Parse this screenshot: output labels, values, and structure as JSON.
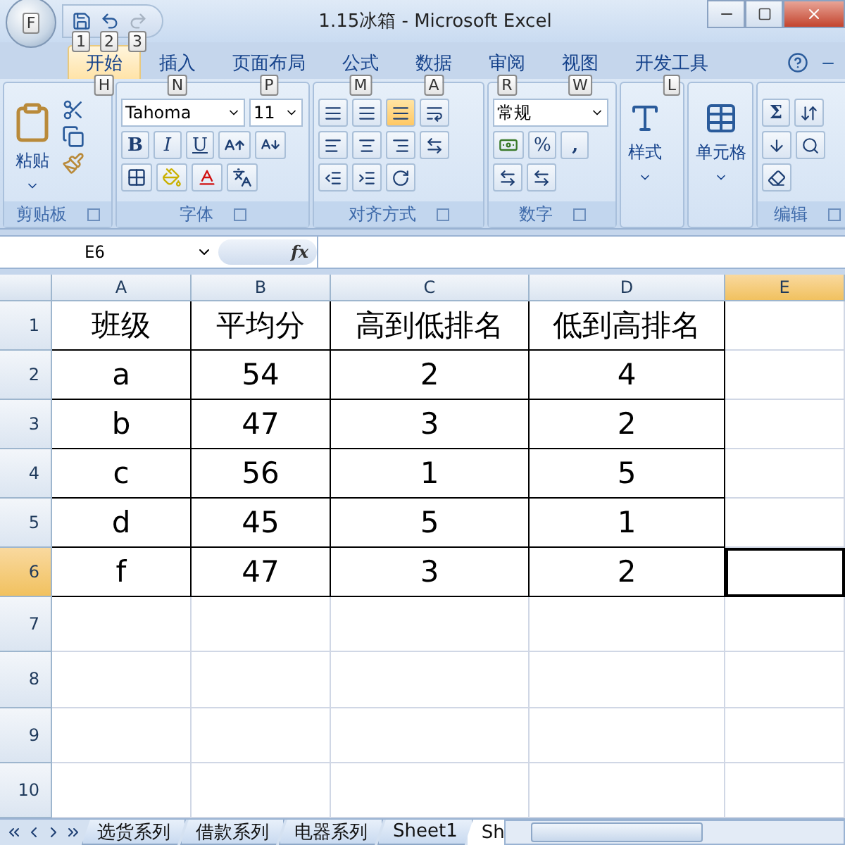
{
  "window": {
    "title": "1.15冰箱 - Microsoft Excel",
    "orb_keytip": "F"
  },
  "quick_access": [
    {
      "kind": "save",
      "keytip": "1",
      "disabled": false
    },
    {
      "kind": "undo",
      "keytip": "2",
      "disabled": false
    },
    {
      "kind": "redo",
      "keytip": "3",
      "disabled": true
    }
  ],
  "tabs": [
    {
      "label": "开始",
      "keytip": "H",
      "selected": true
    },
    {
      "label": "插入",
      "keytip": "N",
      "selected": false
    },
    {
      "label": "页面布局",
      "keytip": "P",
      "selected": false
    },
    {
      "label": "公式",
      "keytip": "M",
      "selected": false
    },
    {
      "label": "数据",
      "keytip": "A",
      "selected": false
    },
    {
      "label": "审阅",
      "keytip": "R",
      "selected": false
    },
    {
      "label": "视图",
      "keytip": "W",
      "selected": false
    },
    {
      "label": "开发工具",
      "keytip": "L",
      "selected": false
    }
  ],
  "ribbon": {
    "groups": [
      {
        "kind": "clipboard",
        "label": "剪贴板",
        "button": "粘贴"
      },
      {
        "kind": "font",
        "label": "字体",
        "font_name": "Tahoma",
        "font_size": "11",
        "style_buttons": [
          "B",
          "I",
          "U"
        ]
      },
      {
        "kind": "alignment",
        "label": "对齐方式"
      },
      {
        "kind": "number",
        "label": "数字",
        "format": "常规",
        "percent": "%",
        "comma": ","
      },
      {
        "kind": "styles",
        "button": "样式"
      },
      {
        "kind": "cells",
        "button": "单元格"
      },
      {
        "kind": "editing",
        "label": "编辑",
        "sum": "Σ"
      }
    ]
  },
  "formula_bar": {
    "name_box": "E6",
    "fx": "fx"
  },
  "sheet": {
    "columns": [
      {
        "label": "A",
        "selected": false
      },
      {
        "label": "B",
        "selected": false
      },
      {
        "label": "C",
        "selected": false
      },
      {
        "label": "D",
        "selected": false
      },
      {
        "label": "E",
        "selected": true
      }
    ],
    "rows": [
      {
        "label": "1",
        "selected": false,
        "cells": [
          "班级",
          "平均分",
          "高到低排名",
          "低到高排名"
        ]
      },
      {
        "label": "2",
        "selected": false,
        "cells": [
          "a",
          "54",
          "2",
          "4"
        ]
      },
      {
        "label": "3",
        "selected": false,
        "cells": [
          "b",
          "47",
          "3",
          "2"
        ]
      },
      {
        "label": "4",
        "selected": false,
        "cells": [
          "c",
          "56",
          "1",
          "5"
        ]
      },
      {
        "label": "5",
        "selected": false,
        "cells": [
          "d",
          "45",
          "5",
          "1"
        ]
      },
      {
        "label": "6",
        "selected": true,
        "cells": [
          "f",
          "47",
          "3",
          "2"
        ]
      },
      {
        "label": "7",
        "selected": false
      },
      {
        "label": "8",
        "selected": false
      },
      {
        "label": "9",
        "selected": false
      },
      {
        "label": "10",
        "selected": false
      }
    ]
  },
  "sheet_tabs": [
    {
      "label": "选货系列",
      "selected": false
    },
    {
      "label": "借款系列",
      "selected": false
    },
    {
      "label": "电器系列",
      "selected": false
    },
    {
      "label": "Sheet1",
      "selected": false
    },
    {
      "label": "Sh",
      "selected": true
    }
  ]
}
